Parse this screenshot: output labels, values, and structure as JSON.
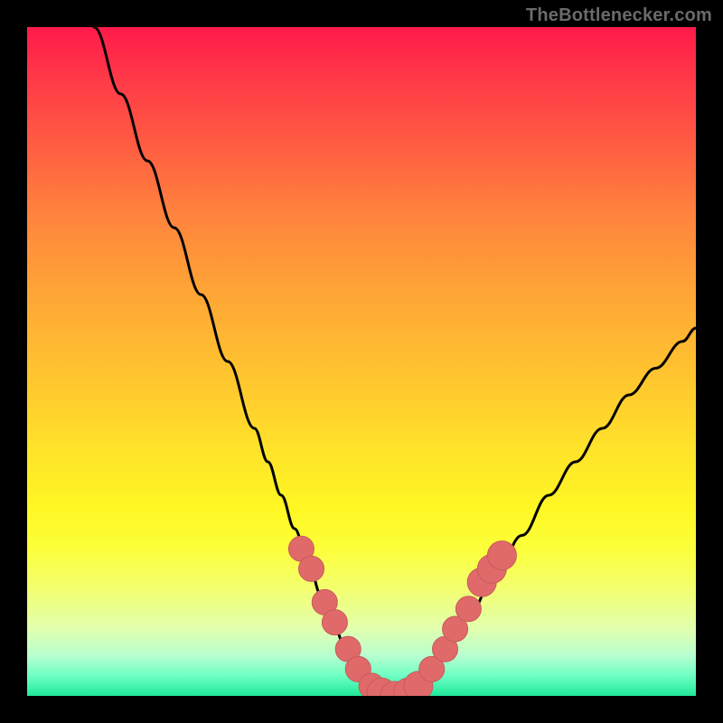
{
  "watermark": "TheBottlenecker.com",
  "colors": {
    "background": "#000000",
    "curve_stroke": "#000000",
    "marker_fill": "#e06a6a",
    "marker_stroke": "#c85a5a",
    "gradient_top": "#ff1a4a",
    "gradient_bottom": "#20e89a"
  },
  "chart_data": {
    "type": "line",
    "title": "",
    "xlabel": "",
    "ylabel": "",
    "xlim": [
      0,
      100
    ],
    "ylim": [
      0,
      100
    ],
    "series": [
      {
        "name": "bottleneck-curve",
        "x": [
          10,
          14,
          18,
          22,
          26,
          30,
          34,
          36,
          38,
          40,
          42,
          44,
          46,
          48,
          50,
          52,
          54,
          56,
          58,
          60,
          62,
          66,
          70,
          74,
          78,
          82,
          86,
          90,
          94,
          98,
          100
        ],
        "y": [
          100,
          90,
          80,
          70,
          60,
          50,
          40,
          35,
          30,
          25,
          20,
          15,
          10,
          6,
          3,
          1,
          0,
          0,
          1,
          3,
          6,
          12,
          18,
          24,
          30,
          35,
          40,
          45,
          49,
          53,
          55
        ]
      }
    ],
    "markers": [
      {
        "x": 41.0,
        "y": 22,
        "r": 1.5
      },
      {
        "x": 42.5,
        "y": 19,
        "r": 1.5
      },
      {
        "x": 44.5,
        "y": 14,
        "r": 1.5
      },
      {
        "x": 46.0,
        "y": 11,
        "r": 1.5
      },
      {
        "x": 48.0,
        "y": 7,
        "r": 1.5
      },
      {
        "x": 49.5,
        "y": 4,
        "r": 1.5
      },
      {
        "x": 51.5,
        "y": 1.5,
        "r": 1.5
      },
      {
        "x": 53.0,
        "y": 0.5,
        "r": 1.8
      },
      {
        "x": 55.0,
        "y": 0.0,
        "r": 1.8
      },
      {
        "x": 57.0,
        "y": 0.5,
        "r": 1.8
      },
      {
        "x": 58.5,
        "y": 1.5,
        "r": 1.8
      },
      {
        "x": 60.5,
        "y": 4,
        "r": 1.5
      },
      {
        "x": 62.5,
        "y": 7,
        "r": 1.5
      },
      {
        "x": 64.0,
        "y": 10,
        "r": 1.5
      },
      {
        "x": 66.0,
        "y": 13,
        "r": 1.5
      },
      {
        "x": 68.0,
        "y": 17,
        "r": 1.8
      },
      {
        "x": 69.5,
        "y": 19,
        "r": 1.8
      },
      {
        "x": 71.0,
        "y": 21,
        "r": 1.8
      }
    ],
    "grid": false,
    "legend": false
  }
}
